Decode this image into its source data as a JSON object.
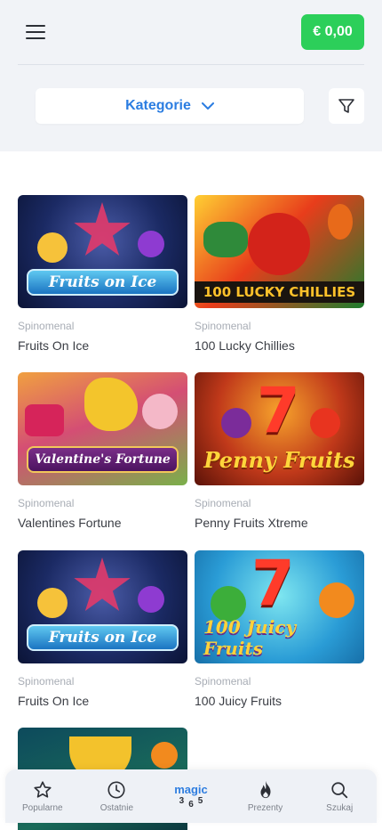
{
  "header": {
    "balance": "€ 0,00",
    "menu_icon": "hamburger-menu-icon"
  },
  "filters": {
    "category_label": "Kategorie",
    "category_icon": "chevron-down-icon",
    "filter_icon": "filter-icon"
  },
  "colors": {
    "accent": "#2b7de1",
    "balance_bg": "#2ccf5a",
    "top_bg": "#f1f3f7"
  },
  "games": [
    {
      "provider": "Spinomenal",
      "title": "Fruits On Ice",
      "art_text": "Fruits on Ice"
    },
    {
      "provider": "Spinomenal",
      "title": "100 Lucky Chillies",
      "art_text": "100 LUCKY CHILLIES"
    },
    {
      "provider": "Spinomenal",
      "title": "Valentines Fortune",
      "art_text": "Valentine's Fortune"
    },
    {
      "provider": "Spinomenal",
      "title": "Penny Fruits Xtreme",
      "art_text": "Penny Fruits"
    },
    {
      "provider": "Spinomenal",
      "title": "Fruits On Ice",
      "art_text": "Fruits on Ice"
    },
    {
      "provider": "Spinomenal",
      "title": "100 Juicy Fruits",
      "art_text": "100 Juicy Fruits"
    }
  ],
  "nav": {
    "popular": "Popularne",
    "recent": "Ostatnie",
    "magic_word": "magic",
    "magic_n1": "3",
    "magic_n2": "6",
    "magic_n3": "5",
    "gifts": "Prezenty",
    "search": "Szukaj"
  }
}
